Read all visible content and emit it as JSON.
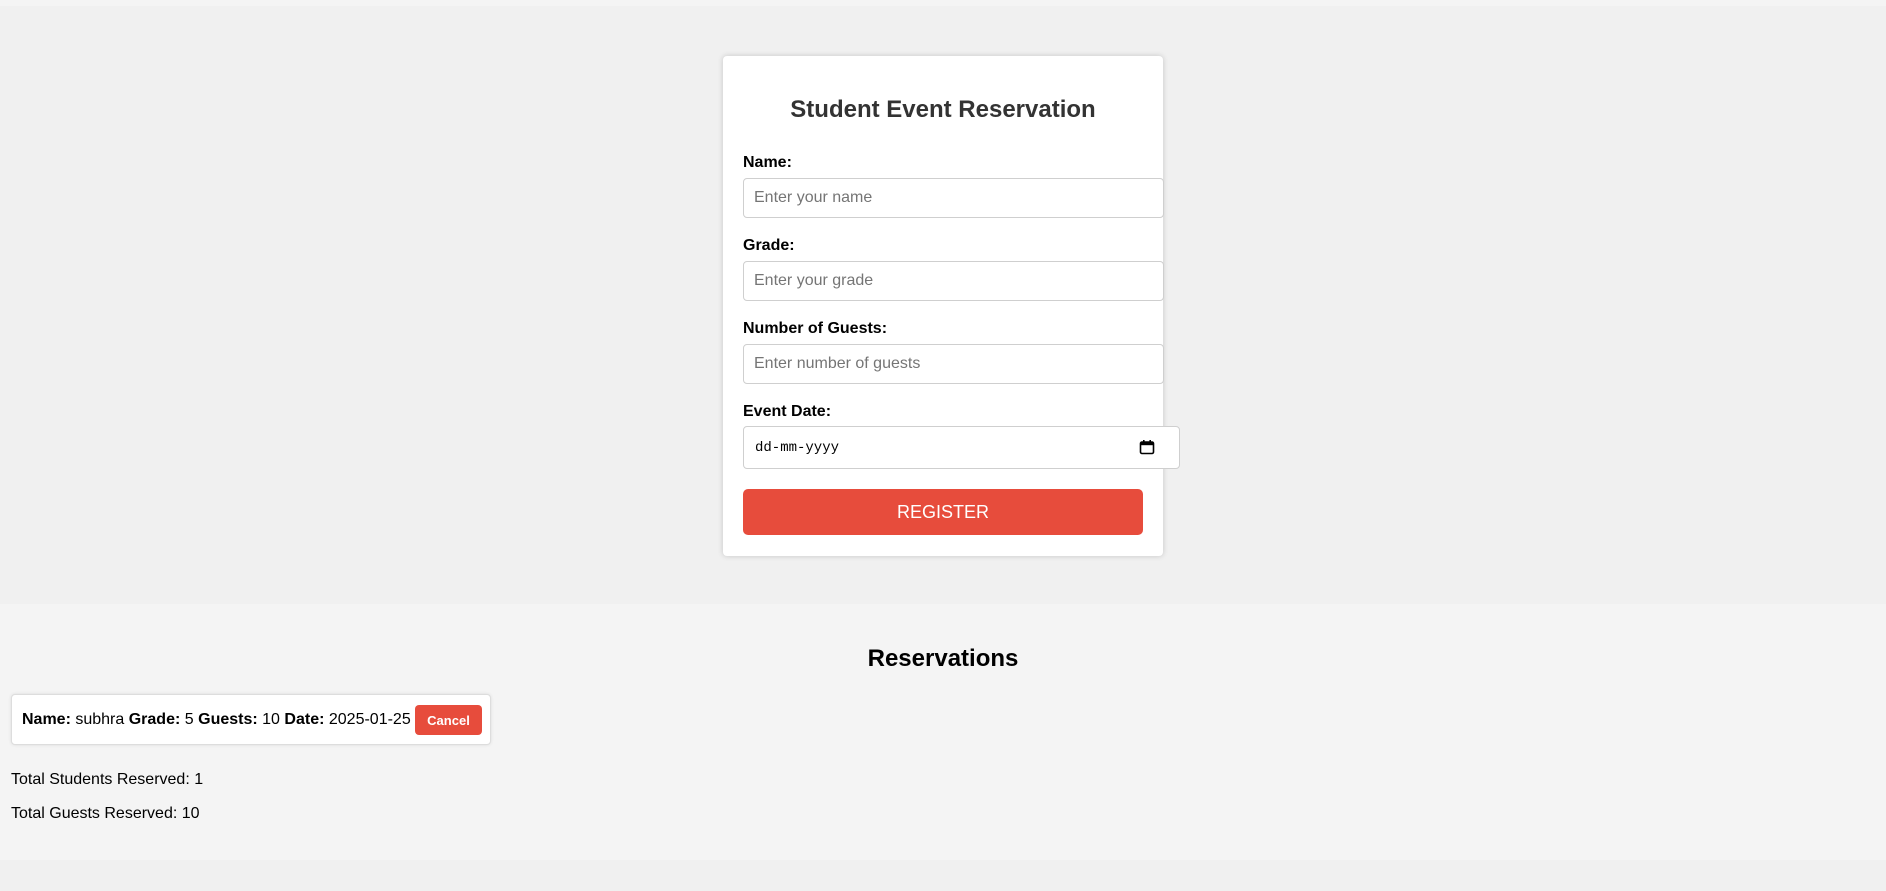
{
  "form": {
    "title": "Student Event Reservation",
    "name_label": "Name:",
    "name_placeholder": "Enter your name",
    "name_value": "",
    "grade_label": "Grade:",
    "grade_placeholder": "Enter your grade",
    "grade_value": "",
    "guests_label": "Number of Guests:",
    "guests_placeholder": "Enter number of guests",
    "guests_value": "",
    "date_label": "Event Date:",
    "date_placeholder": "dd-mm-yyyy",
    "register_label": "REGISTER"
  },
  "reservations": {
    "title": "Reservations",
    "items": [
      {
        "name_label": "Name:",
        "name": "subhra",
        "grade_label": "Grade:",
        "grade": "5",
        "guests_label": "Guests:",
        "guests": "10",
        "date_label": "Date:",
        "date": "2025-01-25",
        "cancel_label": "Cancel"
      }
    ],
    "total_students": "Total Students Reserved: 1",
    "total_guests": "Total Guests Reserved: 10"
  },
  "icons": {
    "calendar": "calendar-icon"
  },
  "colors": {
    "accent": "#e74c3c",
    "page_bg": "#f4f4f4",
    "form_section_bg": "#f0f0f0",
    "card_bg": "#ffffff",
    "title_text": "#333333"
  }
}
